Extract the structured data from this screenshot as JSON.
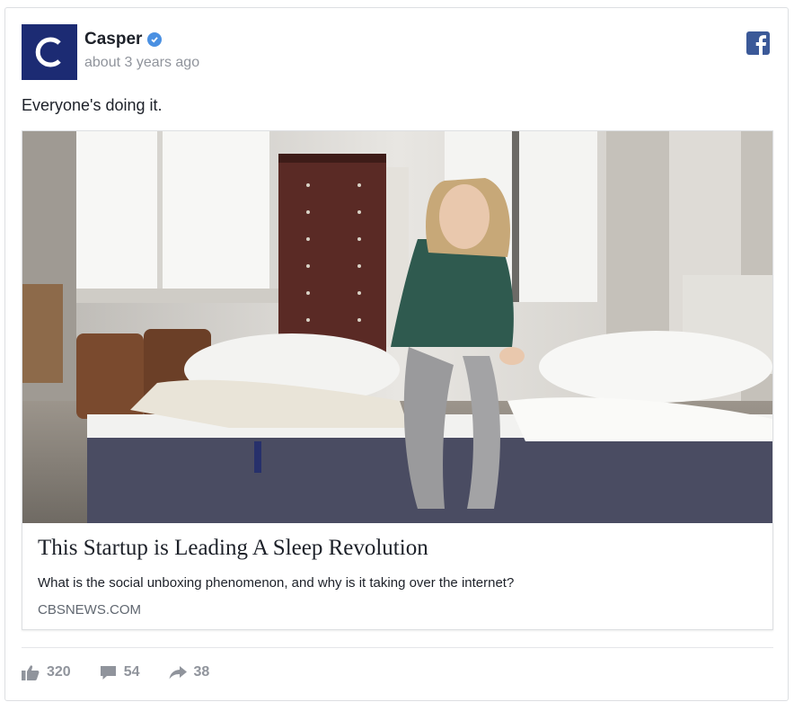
{
  "post": {
    "author": "Casper",
    "avatar_letter": "C",
    "timestamp": "about 3 years ago",
    "text": "Everyone's doing it."
  },
  "link": {
    "title": "This Startup is Leading A Sleep Revolution",
    "description": "What is the social unboxing phenomenon, and why is it taking over the internet?",
    "domain": "CBSNEWS.COM"
  },
  "stats": {
    "likes": "320",
    "comments": "54",
    "shares": "38"
  },
  "icons": {
    "verified": "verified-badge-icon",
    "platform": "facebook-icon",
    "like": "thumbs-up-icon",
    "comment": "comment-icon",
    "share": "share-arrow-icon"
  },
  "colors": {
    "avatar_bg": "#1c2b73",
    "facebook_blue": "#3b5998",
    "verified_blue": "#4a90e2",
    "muted_text": "#90949c"
  }
}
